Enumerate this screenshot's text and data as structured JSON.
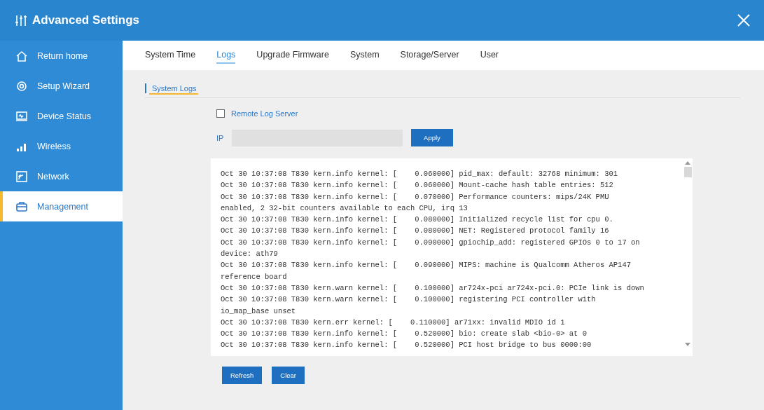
{
  "window": {
    "title": "Advanced Settings"
  },
  "sidebar": {
    "items": [
      {
        "label": "Return home",
        "kind": "home",
        "selected": false
      },
      {
        "label": "Setup Wizard",
        "kind": "gear",
        "selected": false
      },
      {
        "label": "Device Status",
        "kind": "monitor",
        "selected": false
      },
      {
        "label": "Wireless",
        "kind": "signal",
        "selected": false
      },
      {
        "label": "Network",
        "kind": "network",
        "selected": false
      },
      {
        "label": "Management",
        "kind": "briefcase",
        "selected": true
      }
    ]
  },
  "tabs": [
    {
      "label": "System Time",
      "selected": false
    },
    {
      "label": "Logs",
      "selected": true
    },
    {
      "label": "Upgrade Firmware",
      "selected": false
    },
    {
      "label": "System",
      "selected": false
    },
    {
      "label": "Storage/Server",
      "selected": false
    },
    {
      "label": "User",
      "selected": false
    }
  ],
  "section_title": "System Logs",
  "remote_log": {
    "label": "Remote Log Server",
    "checked": false
  },
  "ip_field": {
    "label": "IP"
  },
  "apply_button": "Apply",
  "log_lines": [
    "Oct 30 10:37:08 T830 kern.info kernel: [    0.060000] pid_max: default: 32768 minimum: 301",
    "Oct 30 10:37:08 T830 kern.info kernel: [    0.060000] Mount-cache hash table entries: 512",
    "Oct 30 10:37:08 T830 kern.info kernel: [    0.070000] Performance counters: mips/24K PMU",
    "enabled, 2 32-bit counters available to each CPU, irq 13",
    "Oct 30 10:37:08 T830 kern.info kernel: [    0.080000] Initialized recycle list for cpu 0.",
    "Oct 30 10:37:08 T830 kern.info kernel: [    0.080000] NET: Registered protocol family 16",
    "Oct 30 10:37:08 T830 kern.info kernel: [    0.090000] gpiochip_add: registered GPIOs 0 to 17 on",
    "device: ath79",
    "Oct 30 10:37:08 T830 kern.info kernel: [    0.090000] MIPS: machine is Qualcomm Atheros AP147",
    "reference board",
    "Oct 30 10:37:08 T830 kern.warn kernel: [    0.100000] ar724x-pci ar724x-pci.0: PCIe link is down",
    "Oct 30 10:37:08 T830 kern.warn kernel: [    0.100000] registering PCI controller with",
    "io_map_base unset",
    "Oct 30 10:37:08 T830 kern.err kernel: [    0.110000] ar71xx: invalid MDIO id 1",
    "Oct 30 10:37:08 T830 kern.info kernel: [    0.520000] bio: create slab <bio-0> at 0",
    "Oct 30 10:37:08 T830 kern.info kernel: [    0.520000] PCI host bridge to bus 0000:00"
  ],
  "buttons": [
    "Refresh",
    "Clear"
  ]
}
